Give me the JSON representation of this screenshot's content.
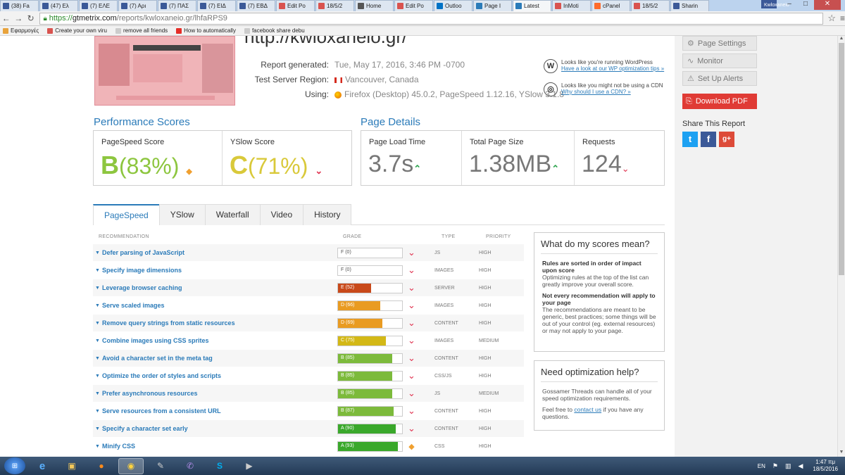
{
  "browser": {
    "tabs": [
      {
        "label": "(38) Fa",
        "icon": "facebook-icon",
        "color": "#3b5998"
      },
      {
        "label": "(47) Ελ",
        "icon": "facebook-icon",
        "color": "#3b5998"
      },
      {
        "label": "(7) ΕΛΕ",
        "icon": "facebook-icon",
        "color": "#3b5998"
      },
      {
        "label": "(7) Αρι",
        "icon": "facebook-icon",
        "color": "#3b5998"
      },
      {
        "label": "(7) ΠΑΣ",
        "icon": "facebook-icon",
        "color": "#3b5998"
      },
      {
        "label": "(7) ΕΙΔ",
        "icon": "facebook-icon",
        "color": "#3b5998"
      },
      {
        "label": "(7) ΕΒΔ",
        "icon": "facebook-icon",
        "color": "#3b5998"
      },
      {
        "label": "Edit Po",
        "icon": "inmotion-icon",
        "color": "#d9534f"
      },
      {
        "label": "18/5/2",
        "icon": "inmotion-icon",
        "color": "#d9534f"
      },
      {
        "label": "Home",
        "icon": "wordpress-icon",
        "color": "#555555"
      },
      {
        "label": "Edit Po",
        "icon": "inmotion-icon",
        "color": "#d9534f"
      },
      {
        "label": "Outloo",
        "icon": "outlook-icon",
        "color": "#0072c6"
      },
      {
        "label": "Page I",
        "icon": "pingdom-icon",
        "color": "#2b7bb9"
      },
      {
        "label": "Latest ",
        "icon": "gtmetrix-icon",
        "color": "#2b7bb9",
        "active": true
      },
      {
        "label": "InMoti",
        "icon": "inmotion-icon",
        "color": "#d9534f"
      },
      {
        "label": "cPanel",
        "icon": "cpanel-icon",
        "color": "#ff6c2c"
      },
      {
        "label": "18/5/2",
        "icon": "inmotion-icon",
        "color": "#d9534f"
      },
      {
        "label": "Sharin",
        "icon": "facebook-icon",
        "color": "#3b5998"
      }
    ],
    "profile": "Kwloxaneio",
    "url": {
      "scheme": "https://",
      "host": "gtmetrix.com",
      "path": "/reports/kwloxaneio.gr/lhfaRPS9"
    },
    "bookmarks": [
      {
        "label": "Εφαρμογές",
        "icon": "apps-icon",
        "color": "#e8a33c"
      },
      {
        "label": "Create your own viru",
        "icon": "bookmark-icon",
        "color": "#d9534f"
      },
      {
        "label": "remove all friends",
        "icon": "page-icon",
        "color": "#cccccc"
      },
      {
        "label": "How to automatically",
        "icon": "youtube-icon",
        "color": "#e52d27"
      },
      {
        "label": "facebook share debu",
        "icon": "page-icon",
        "color": "#cccccc"
      }
    ]
  },
  "report": {
    "site_title": "http://kwloxaneio.gr/",
    "generated_label": "Report generated:",
    "generated_value": "Tue, May 17, 2016, 3:46 PM -0700",
    "region_label": "Test Server Region:",
    "region_value": "Vancouver, Canada",
    "using_label": "Using:",
    "using_value": "Firefox (Desktop) 45.0.2, PageSpeed 1.12.16, YSlow 3.1.8",
    "tip_wp_text": "Looks like you're running WordPress",
    "tip_wp_link": "Have a look at our WP optimization tips »",
    "tip_cdn_text": "Looks like you might not be using a CDN",
    "tip_cdn_link": "Why should I use a CDN? »"
  },
  "scores": {
    "heading": "Performance Scores",
    "pagespeed_label": "PageSpeed Score",
    "pagespeed_grade": "B",
    "pagespeed_pct": "(83%)",
    "yslow_label": "YSlow Score",
    "yslow_grade": "C",
    "yslow_pct": "(71%)"
  },
  "details": {
    "heading": "Page Details",
    "load_label": "Page Load Time",
    "load_value": "3.7s",
    "size_label": "Total Page Size",
    "size_value": "1.38MB",
    "req_label": "Requests",
    "req_value": "124"
  },
  "tabs": [
    "PageSpeed",
    "YSlow",
    "Waterfall",
    "Video",
    "History"
  ],
  "table": {
    "headers": {
      "rec": "RECOMMENDATION",
      "grade": "GRADE",
      "type": "TYPE",
      "priority": "PRIORITY"
    },
    "rows": [
      {
        "rec": "Defer parsing of JavaScript",
        "grade": "F (0)",
        "pct": 0,
        "color": "#c9302c",
        "icon": "down",
        "type": "JS",
        "priority": "HIGH"
      },
      {
        "rec": "Specify image dimensions",
        "grade": "F (0)",
        "pct": 0,
        "color": "#c9302c",
        "icon": "down",
        "type": "IMAGES",
        "priority": "HIGH"
      },
      {
        "rec": "Leverage browser caching",
        "grade": "E (52)",
        "pct": 52,
        "color": "#c8491a",
        "icon": "down",
        "type": "SERVER",
        "priority": "HIGH"
      },
      {
        "rec": "Serve scaled images",
        "grade": "D (66)",
        "pct": 66,
        "color": "#e99b22",
        "icon": "down",
        "type": "IMAGES",
        "priority": "HIGH"
      },
      {
        "rec": "Remove query strings from static resources",
        "grade": "D (69)",
        "pct": 69,
        "color": "#e99b22",
        "icon": "down",
        "type": "CONTENT",
        "priority": "HIGH"
      },
      {
        "rec": "Combine images using CSS sprites",
        "grade": "C (75)",
        "pct": 75,
        "color": "#d3b816",
        "icon": "down",
        "type": "IMAGES",
        "priority": "MEDIUM"
      },
      {
        "rec": "Avoid a character set in the meta tag",
        "grade": "B (85)",
        "pct": 85,
        "color": "#7cba3b",
        "icon": "down",
        "type": "CONTENT",
        "priority": "HIGH"
      },
      {
        "rec": "Optimize the order of styles and scripts",
        "grade": "B (85)",
        "pct": 85,
        "color": "#7cba3b",
        "icon": "down",
        "type": "CSS/JS",
        "priority": "HIGH"
      },
      {
        "rec": "Prefer asynchronous resources",
        "grade": "B (85)",
        "pct": 85,
        "color": "#7cba3b",
        "icon": "down",
        "type": "JS",
        "priority": "MEDIUM"
      },
      {
        "rec": "Serve resources from a consistent URL",
        "grade": "B (87)",
        "pct": 87,
        "color": "#7cba3b",
        "icon": "down",
        "type": "CONTENT",
        "priority": "HIGH"
      },
      {
        "rec": "Specify a character set early",
        "grade": "A (90)",
        "pct": 90,
        "color": "#3aa82b",
        "icon": "down",
        "type": "CONTENT",
        "priority": "HIGH"
      },
      {
        "rec": "Minify CSS",
        "grade": "A (93)",
        "pct": 93,
        "color": "#3aa82b",
        "icon": "diamond",
        "type": "CSS",
        "priority": "HIGH"
      }
    ]
  },
  "info1": {
    "title": "What do my scores mean?",
    "b1": "Rules are sorted in order of impact upon score",
    "p1": "Optimizing rules at the top of the list can greatly improve your overall score.",
    "b2": "Not every recommendation will apply to your page",
    "p2": "The recommendations are meant to be generic, best practices; some things will be out of your control (eg. external resources) or may not apply to your page."
  },
  "info2": {
    "title": "Need optimization help?",
    "p1": "Gossamer Threads can handle all of your speed optimization requirements.",
    "p2_pre": "Feel free to ",
    "p2_link": "contact us",
    "p2_post": " if you have any questions."
  },
  "sidebar": {
    "page_settings": "Page Settings",
    "monitor": "Monitor",
    "alerts": "Set Up Alerts",
    "download": "Download PDF",
    "share": "Share This Report"
  },
  "taskbar": {
    "lang": "EN",
    "time": "1:47 πμ",
    "date": "18/5/2016"
  }
}
